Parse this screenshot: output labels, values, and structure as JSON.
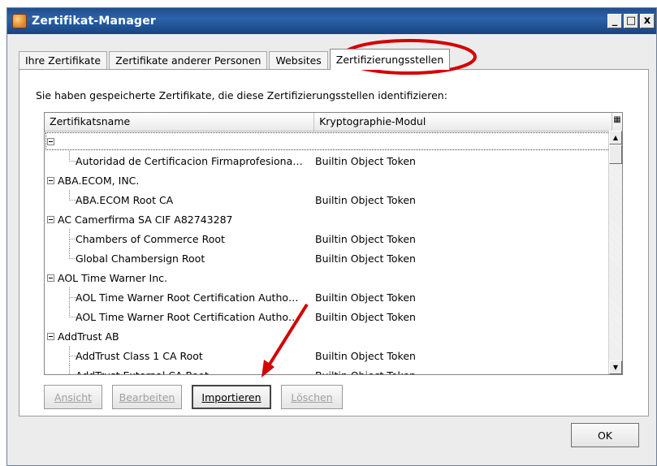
{
  "window": {
    "title": "Zertifikat-Manager",
    "controls": [
      "_",
      "□",
      "x"
    ]
  },
  "tabs": [
    {
      "label": "Ihre Zertifikate"
    },
    {
      "label": "Zertifikate anderer Personen"
    },
    {
      "label": "Websites"
    },
    {
      "label": "Zertifizierungsstellen"
    }
  ],
  "active_tab": "Zertifizierungsstellen",
  "hint": "Sie haben gespeicherte Zertifikate, die diese Zertifizierungsstellen identifizieren:",
  "table": {
    "columns": [
      "Zertifikatsname",
      "Kryptographie-Modul"
    ],
    "rows": [
      {
        "type": "group",
        "name": "",
        "module": ""
      },
      {
        "type": "child",
        "name": "Autoridad de Certificacion Firmaprofesiona…",
        "module": "Builtin Object Token"
      },
      {
        "type": "group",
        "name": "ABA.ECOM, INC.",
        "module": ""
      },
      {
        "type": "child",
        "name": "ABA.ECOM Root CA",
        "module": "Builtin Object Token"
      },
      {
        "type": "group",
        "name": "AC Camerfirma SA CIF A82743287",
        "module": ""
      },
      {
        "type": "child",
        "name": "Chambers of Commerce Root",
        "module": "Builtin Object Token"
      },
      {
        "type": "child",
        "name": "Global Chambersign Root",
        "module": "Builtin Object Token"
      },
      {
        "type": "group",
        "name": "AOL Time Warner Inc.",
        "module": ""
      },
      {
        "type": "child",
        "name": "AOL Time Warner Root Certification Autho…",
        "module": "Builtin Object Token"
      },
      {
        "type": "child",
        "name": "AOL Time Warner Root Certification Autho…",
        "module": "Builtin Object Token"
      },
      {
        "type": "group",
        "name": "AddTrust AB",
        "module": ""
      },
      {
        "type": "child",
        "name": "AddTrust Class 1 CA Root",
        "module": "Builtin Object Token"
      },
      {
        "type": "child",
        "name": "AddTrust External CA Root",
        "module": "Builtin Object Token"
      }
    ]
  },
  "buttons": {
    "view": "Ansicht",
    "edit": "Bearbeiten",
    "import": "Importieren",
    "delete": "Löschen",
    "ok": "OK"
  },
  "annotation_color": "#d40000"
}
